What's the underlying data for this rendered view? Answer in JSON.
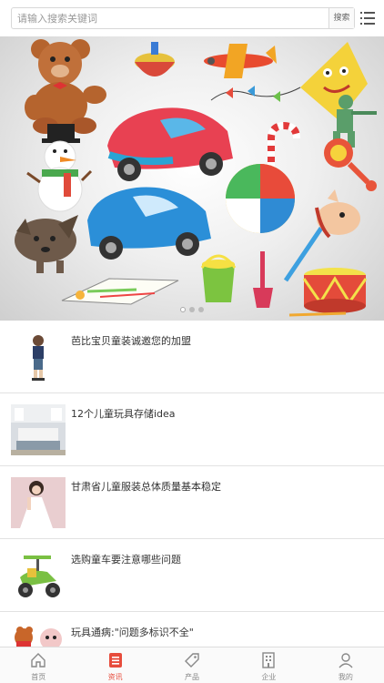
{
  "search": {
    "placeholder": "请输入搜索关键词",
    "button_label": "搜索",
    "menu_icon": "list-menu-icon"
  },
  "banner": {
    "image": "toys-illustration",
    "dots": 3,
    "active_dot": 0
  },
  "news": [
    {
      "title": "芭比宝贝童装诚邀您的加盟",
      "thumb": "child-photo"
    },
    {
      "title": "12个儿童玩具存储idea",
      "thumb": "room-photo"
    },
    {
      "title": "甘肃省儿童服装总体质量基本稳定",
      "thumb": "girl-dress-photo"
    },
    {
      "title": "选购童车要注意哪些问题",
      "thumb": "kids-motorbike-photo"
    },
    {
      "title": "玩具通病:\"问题多标识不全\"",
      "thumb": "plush-toys-photo"
    }
  ],
  "tabbar": {
    "active": "资讯",
    "accent_color": "#e74c3c",
    "items": [
      {
        "label": "首页",
        "icon": "home-icon"
      },
      {
        "label": "资讯",
        "icon": "news-icon"
      },
      {
        "label": "产品",
        "icon": "tag-icon"
      },
      {
        "label": "企业",
        "icon": "building-icon"
      },
      {
        "label": "我的",
        "icon": "user-icon"
      }
    ]
  }
}
